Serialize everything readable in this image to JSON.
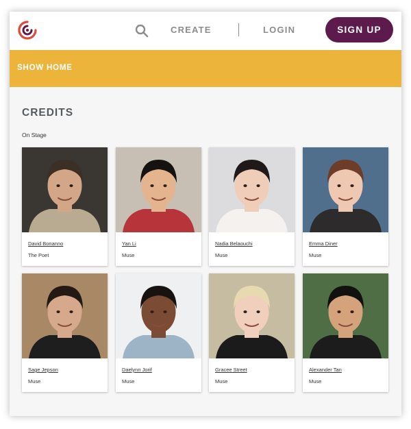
{
  "brand": {
    "primary": "#5c1a4d",
    "accent": "#ecb43b",
    "logo_red": "#e04a3a",
    "logo_purple": "#5c1a4d"
  },
  "nav": {
    "search_icon": "search-icon",
    "create_label": "CREATE",
    "login_label": "LOGIN",
    "signup_label": "SIGN UP"
  },
  "show_bar": {
    "home_label": "SHOW HOME"
  },
  "credits": {
    "title": "CREDITS",
    "section_label": "On Stage",
    "people": [
      {
        "name": "David Bonanno",
        "role": "The Poet",
        "bg": "#3a3632",
        "skin": "#d3a687",
        "hair": "#3b2f26",
        "shirt": "#b9ab92"
      },
      {
        "name": "Yan Li",
        "role": "Muse",
        "bg": "#c7bfb3",
        "skin": "#e4b48f",
        "hair": "#16120f",
        "shirt": "#b8343b"
      },
      {
        "name": "Nadia Belaouchi",
        "role": "Muse",
        "bg": "#dcdcdf",
        "skin": "#f0cdb8",
        "hair": "#1f1a19",
        "shirt": "#f4f1ee"
      },
      {
        "name": "Emma Diner",
        "role": "Muse",
        "bg": "#4f6f8c",
        "skin": "#efc8b1",
        "hair": "#6d3d2a",
        "shirt": "#2d2b2c"
      },
      {
        "name": "Sage Jepson",
        "role": "Muse",
        "bg": "#a98866",
        "skin": "#d7a98c",
        "hair": "#241a14",
        "shirt": "#1e1e1e"
      },
      {
        "name": "Daelynn Jorif",
        "role": "Muse",
        "bg": "#eef0f2",
        "skin": "#7b4b33",
        "hair": "#181311",
        "shirt": "#9db4c7"
      },
      {
        "name": "Gracee Street",
        "role": "Muse",
        "bg": "#c6bca2",
        "skin": "#f0d0bd",
        "hair": "#e7dab0",
        "shirt": "#1b1b1b"
      },
      {
        "name": "Alexander Tan",
        "role": "Muse",
        "bg": "#4f6e46",
        "skin": "#d4a27b",
        "hair": "#121110",
        "shirt": "#1c1c1c"
      }
    ]
  }
}
